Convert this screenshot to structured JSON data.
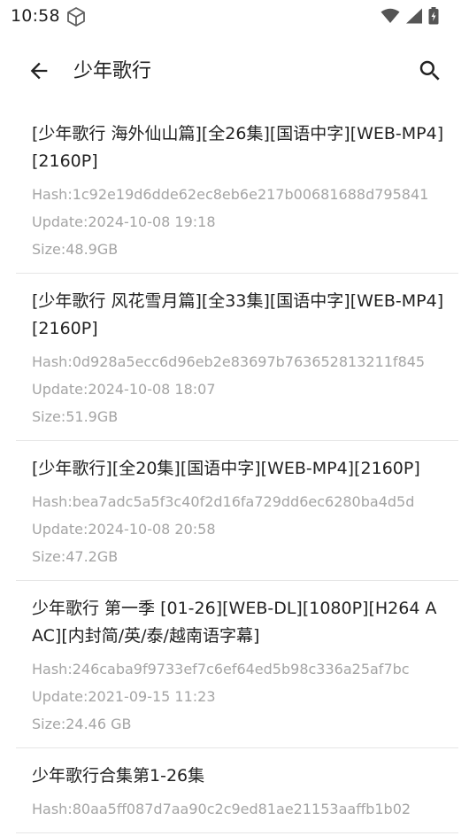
{
  "status_bar": {
    "time": "10:58"
  },
  "app_bar": {
    "title": "少年歌行"
  },
  "results": [
    {
      "title": "[少年歌行 海外仙山篇][全26集][国语中字][WEB-MP4][2160P]",
      "hash": "Hash:1c92e19d6dde62ec8eb6e217b00681688d795841",
      "update": "Update:2024-10-08 19:18",
      "size": "Size:48.9GB"
    },
    {
      "title": "[少年歌行 风花雪月篇][全33集][国语中字][WEB-MP4][2160P]",
      "hash": "Hash:0d928a5ecc6d96eb2e83697b763652813211f845",
      "update": "Update:2024-10-08 18:07",
      "size": "Size:51.9GB"
    },
    {
      "title": "[少年歌行][全20集][国语中字][WEB-MP4][2160P]",
      "hash": "Hash:bea7adc5a5f3c40f2d16fa729dd6ec6280ba4d5d",
      "update": "Update:2024-10-08 20:58",
      "size": "Size:47.2GB"
    },
    {
      "title": "少年歌行 第一季 [01-26][WEB-DL][1080P][H264 AAC][内封简/英/泰/越南语字幕]",
      "hash": "Hash:246caba9f9733ef7c6ef64ed5b98c336a25af7bc",
      "update": "Update:2021-09-15 11:23",
      "size": "Size:24.46 GB"
    },
    {
      "title": "少年歌行合集第1-26集",
      "hash": "Hash:80aa5ff087d7aa90c2c9ed81ae21153aaffb1b02",
      "update": "",
      "size": ""
    }
  ]
}
